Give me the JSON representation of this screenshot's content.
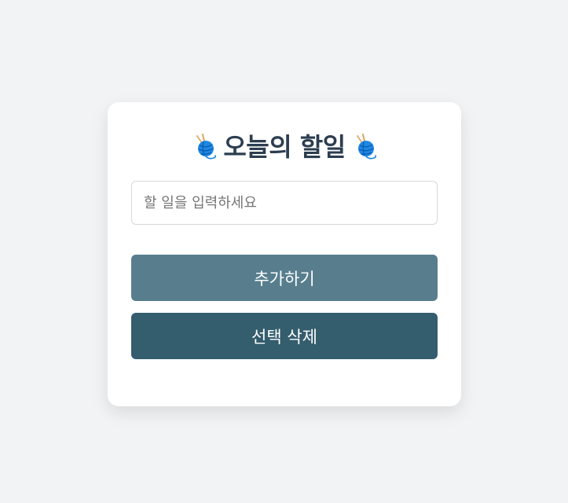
{
  "app": {
    "title": "오늘의 할일",
    "title_icon": "yarn-ball-icon"
  },
  "form": {
    "task_input": {
      "value": "",
      "placeholder": "할 일을 입력하세요"
    },
    "add_button_label": "추가하기",
    "delete_selected_button_label": "선택 삭제"
  },
  "colors": {
    "background": "#f2f3f5",
    "card": "#ffffff",
    "title_text": "#2c3e50",
    "add_button": "#587e8e",
    "delete_button": "#345d6e",
    "yarn_ball": "#1e88e5",
    "knitting_needles": "#e0b072"
  }
}
